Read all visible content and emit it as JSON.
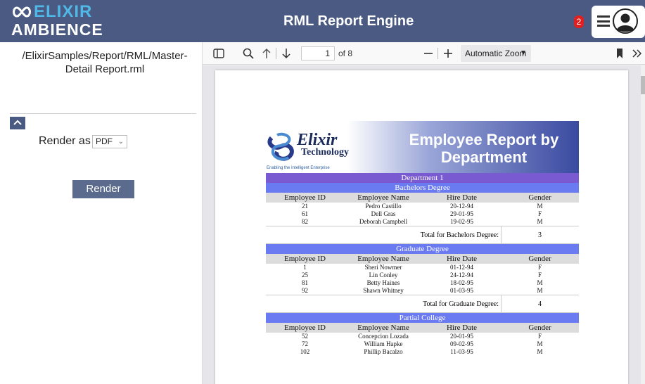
{
  "header": {
    "logo_top": "ELIXIR",
    "logo_bottom": "AMBIENCE",
    "title": "RML Report Engine",
    "notification_count": "2"
  },
  "sidebar": {
    "report_path": "/ElixirSamples/Report/RML/Master-Detail Report.rml",
    "render_as_label": "Render as",
    "format_value": "PDF",
    "render_button": "Render"
  },
  "viewer": {
    "page_number": "1",
    "page_of": "of 8",
    "zoom_value": "Automatic Zoom"
  },
  "report": {
    "brand_name": "Elixir",
    "brand_sub": "Technology",
    "brand_tagline": "Enabling the Intelligent Enterprise",
    "title": "Employee Report by Department",
    "department": "Department 1",
    "columns": [
      "Employee ID",
      "Employee Name",
      "Hire Date",
      "Gender"
    ],
    "groups": [
      {
        "name": "Bachelors Degree",
        "rows": [
          [
            "21",
            "Pedro Castillo",
            "20-12-94",
            "M"
          ],
          [
            "61",
            "Dell Gras",
            "29-01-95",
            "F"
          ],
          [
            "82",
            "Deborah Campbell",
            "19-02-95",
            "M"
          ]
        ],
        "total_label": "Total for Bachelors Degree:",
        "total_value": "3"
      },
      {
        "name": "Graduate Degree",
        "rows": [
          [
            "1",
            "Sheri Nowmer",
            "01-12-94",
            "F"
          ],
          [
            "25",
            "Lin Conley",
            "24-12-94",
            "F"
          ],
          [
            "81",
            "Betty Haines",
            "18-02-95",
            "M"
          ],
          [
            "92",
            "Shawn Whitney",
            "01-03-95",
            "M"
          ]
        ],
        "total_label": "Total for Graduate Degree:",
        "total_value": "4"
      },
      {
        "name": "Partial College",
        "rows": [
          [
            "52",
            "Concepcion Lozada",
            "20-01-95",
            "F"
          ],
          [
            "72",
            "William Hapke",
            "09-02-95",
            "M"
          ],
          [
            "102",
            "Phillip Bacalzo",
            "11-03-95",
            "M"
          ]
        ]
      }
    ]
  },
  "colors": {
    "header_bg": "#4a5a82",
    "logo_accent": "#4fb8e6",
    "department_band": "#7a5ad0",
    "group_band": "#6a7af0",
    "badge": "#e02020"
  },
  "icons": {
    "sidebar_toggle": "sidebar-toggle-icon",
    "search": "search-icon",
    "previous": "arrow-up-icon",
    "next": "arrow-down-icon",
    "zoom_out": "minus-icon",
    "zoom_in": "plus-icon",
    "bookmark": "bookmark-icon",
    "more": "double-chevron-right-icon",
    "menu": "hamburger-icon",
    "user": "avatar-icon"
  }
}
